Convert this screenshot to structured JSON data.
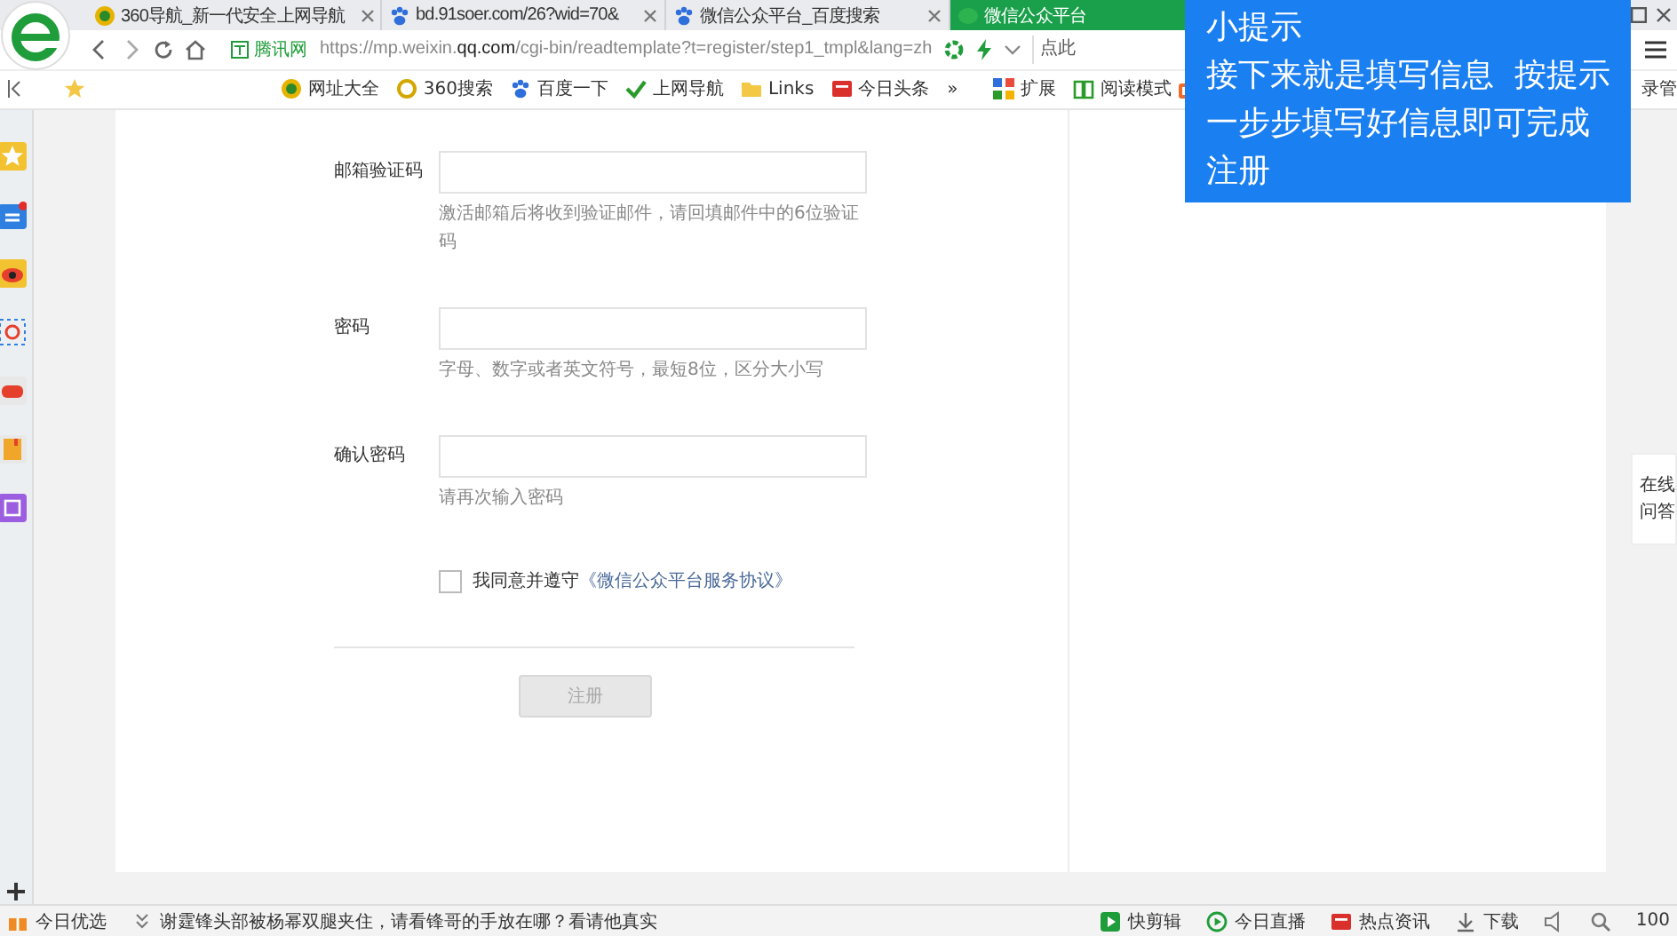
{
  "tabs": [
    {
      "label": "360导航_新一代安全上网导航",
      "selected": false
    },
    {
      "label": "bd.91soer.com/26?wid=70&",
      "selected": false
    },
    {
      "label": "微信公众平台_百度搜索",
      "selected": false
    },
    {
      "label": "微信公众平台",
      "selected": true
    }
  ],
  "address_bar": {
    "site_badge": "腾讯网",
    "url": "https://mp.weixin.**qq.com**/cgi-bin/readtemplate?t=register/step1_tmpl&lang=zh",
    "search_placeholder": "点此"
  },
  "bookmarks": [
    "网址大全",
    "360搜索",
    "百度一下",
    "上网导航",
    "Links",
    "今日头条",
    "»"
  ],
  "bookmarks_right": [
    "扩展",
    "阅读模式"
  ],
  "login": "录管",
  "form": {
    "fields": [
      {
        "label": "邮箱验证码",
        "hint": "激活邮箱后将收到验证邮件，请回填邮件中的6位验证码"
      },
      {
        "label": "密码",
        "hint": "字母、数字或者英文符号，最短8位，区分大小写"
      },
      {
        "label": "确认密码",
        "hint": "请再次输入密码"
      }
    ],
    "agreement": {
      "checked": false,
      "text": "我同意并遵守",
      "link": "《微信公众平台服务协议》"
    },
    "submit": {
      "label": "注册",
      "disabled": true
    }
  },
  "help_float": "在线问答",
  "tooltip": {
    "title": "小提示",
    "body": "接下来就是填写信息  按提示一步步填写好信息即可完成注册"
  },
  "status_bar": {
    "left": [
      "今日优选",
      "谢霆锋头部被杨幂双腿夹住，请看锋哥的手放在哪？看请他真实"
    ],
    "right": [
      "快剪辑",
      "今日直播",
      "热点资讯",
      "下载"
    ],
    "zoom": "100"
  }
}
